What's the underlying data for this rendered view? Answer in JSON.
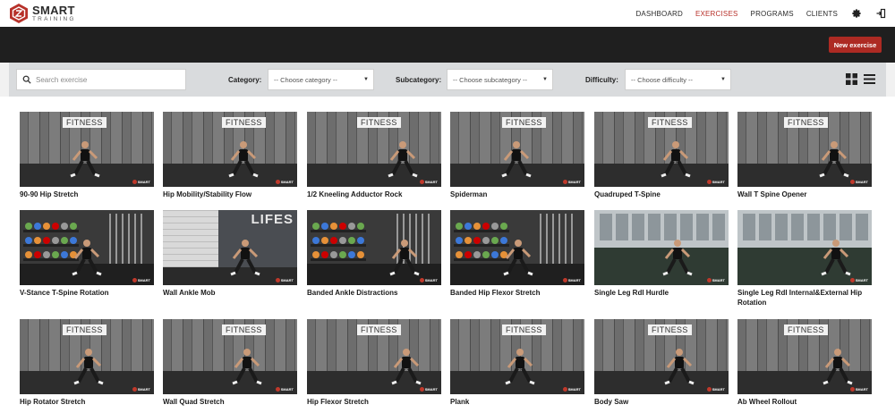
{
  "brand": {
    "name": "SMART",
    "tagline": "TRAINING",
    "accent": "#b7312a"
  },
  "nav": {
    "items": [
      {
        "label": "DASHBOARD",
        "active": false
      },
      {
        "label": "EXERCISES",
        "active": true
      },
      {
        "label": "PROGRAMS",
        "active": false
      },
      {
        "label": "CLIENTS",
        "active": false
      }
    ],
    "icons": [
      "gear-icon",
      "logout-icon"
    ]
  },
  "actions": {
    "new_exercise": "New exercise"
  },
  "filters": {
    "search_placeholder": "Search exercise",
    "category_label": "Category:",
    "category_value": "-- Choose category --",
    "subcategory_label": "Subcategory:",
    "subcategory_value": "-- Choose subcategory --",
    "difficulty_label": "Difficulty:",
    "difficulty_value": "-- Choose difficulty --",
    "views": [
      "grid-view-icon",
      "list-view-icon"
    ]
  },
  "exercises": [
    {
      "title": "90-90 Hip Stretch",
      "scene": "gym",
      "board": "FITNESS"
    },
    {
      "title": "Hip Mobility/Stability Flow",
      "scene": "gym",
      "board": "FITNESS"
    },
    {
      "title": "1/2 Kneeling Adductor Rock",
      "scene": "gym",
      "board": "FITNESS"
    },
    {
      "title": "Spiderman",
      "scene": "gym",
      "board": "FITNESS"
    },
    {
      "title": "Quadruped T-Spine",
      "scene": "gym",
      "board": "FITNESS"
    },
    {
      "title": "Wall T Spine Opener",
      "scene": "gym",
      "board": "FITNESS"
    },
    {
      "title": "V-Stance T-Spine Rotation",
      "scene": "rack",
      "board": ""
    },
    {
      "title": "Wall Ankle Mob",
      "scene": "life",
      "board": "LIFES"
    },
    {
      "title": "Banded Ankle Distractions",
      "scene": "rack",
      "board": ""
    },
    {
      "title": "Banded Hip Flexor Stretch",
      "scene": "rack",
      "board": ""
    },
    {
      "title": "Single Leg Rdl Hurdle",
      "scene": "turf",
      "board": ""
    },
    {
      "title": "Single Leg Rdl Internal&External Hip Rotation",
      "scene": "turf",
      "board": ""
    },
    {
      "title": "Hip Rotator Stretch",
      "scene": "gym",
      "board": "FITNESS"
    },
    {
      "title": "Wall Quad Stretch",
      "scene": "gym",
      "board": "FITNESS"
    },
    {
      "title": "Hip Flexor Stretch",
      "scene": "gym",
      "board": "FITNESS"
    },
    {
      "title": "Plank",
      "scene": "gym",
      "board": "FITNESS"
    },
    {
      "title": "Body Saw",
      "scene": "gym",
      "board": "FITNESS"
    },
    {
      "title": "Ab Wheel Rollout",
      "scene": "gym",
      "board": "FITNESS"
    }
  ],
  "watermark": {
    "text": "SMART"
  }
}
